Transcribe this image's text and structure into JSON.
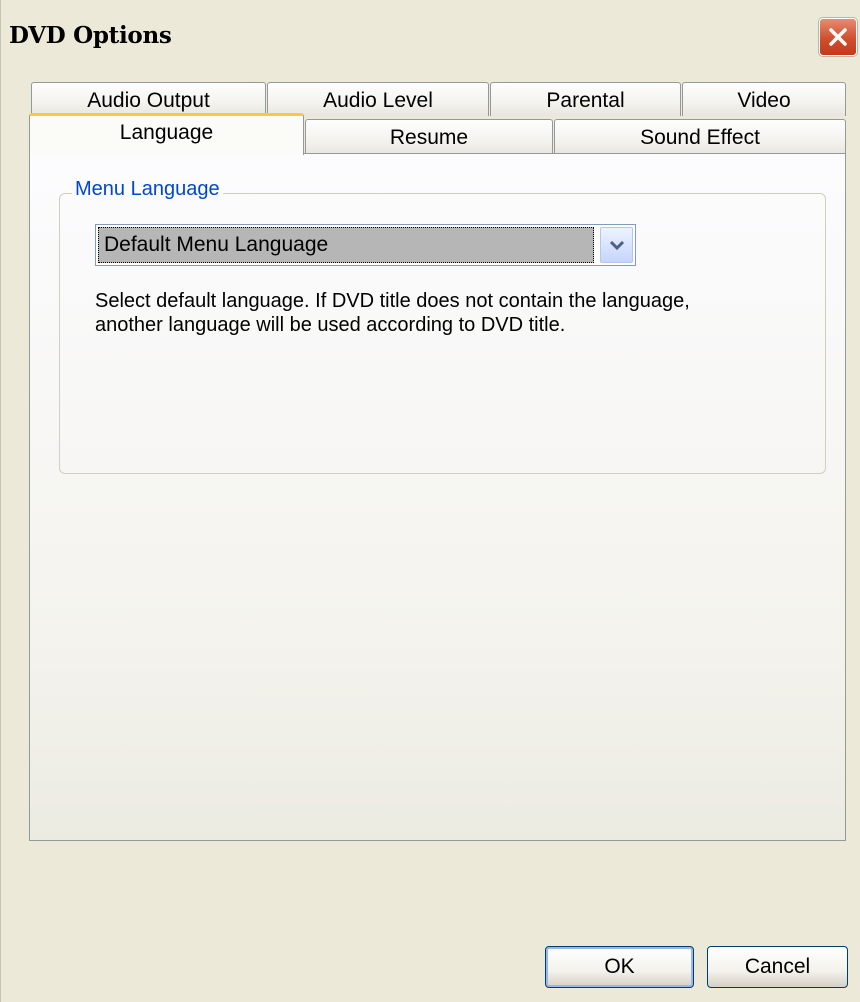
{
  "window": {
    "title": "DVD Options",
    "close_icon": "close-icon"
  },
  "tabs": {
    "row1": [
      {
        "label": "Audio Output"
      },
      {
        "label": "Audio Level"
      },
      {
        "label": "Parental"
      },
      {
        "label": "Video"
      }
    ],
    "row2": [
      {
        "label": "Language",
        "selected": true
      },
      {
        "label": "Resume"
      },
      {
        "label": "Sound Effect"
      }
    ]
  },
  "group": {
    "label": "Menu Language",
    "select_value": "Default Menu Language",
    "description_line1": "Select default language. If DVD title does not contain the language,",
    "description_line2": "another language will be used according to DVD title."
  },
  "buttons": {
    "ok": "OK",
    "cancel": "Cancel"
  },
  "colors": {
    "accent_tab": "#ffc83c",
    "group_label": "#0046d5",
    "close_button": "#d04f2e"
  }
}
